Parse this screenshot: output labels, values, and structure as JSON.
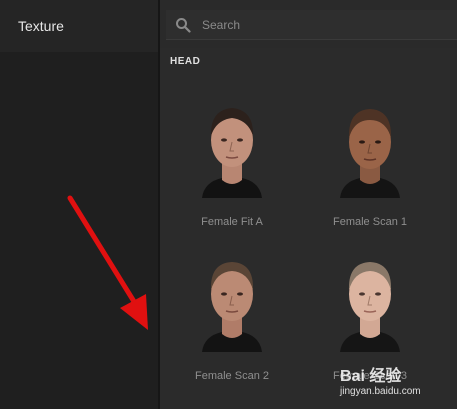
{
  "sidebar": {
    "title": "Texture"
  },
  "search": {
    "placeholder": "Search"
  },
  "section": {
    "title": "HEAD"
  },
  "tiles": [
    {
      "label": "Female Fit A"
    },
    {
      "label": "Female Scan 1"
    },
    {
      "label": "Female Scan 2"
    },
    {
      "label": "Female Scan 3"
    }
  ],
  "watermark": {
    "logo": "Bai 经验",
    "url": "jingyan.baidu.com"
  },
  "colors": {
    "annotation_arrow": "#e01010",
    "background": "#2b2b2b",
    "sidebar": "#1f1f1f"
  }
}
